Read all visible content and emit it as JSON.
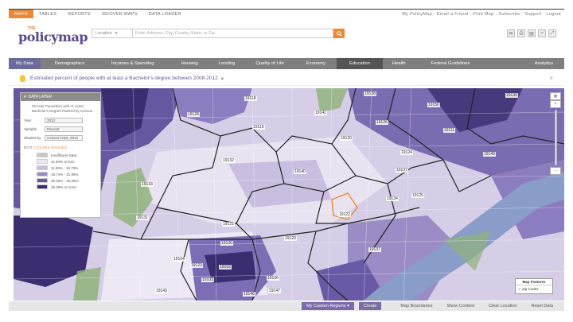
{
  "topnav": {
    "items": [
      "MAPS",
      "TABLES",
      "REPORTS",
      "3D/OVER MAPS",
      "DATA LOADER"
    ],
    "links": "My PolicyMap · Email a Friend · Print Map · Subscribe · Support · Logout"
  },
  "logo": {
    "the": "THE",
    "word": "policymap"
  },
  "search": {
    "location": "Location",
    "placeholder": "Enter Address, City, County, State, or Zip"
  },
  "menubar": {
    "items": [
      "My Data",
      "Demographics",
      "Incomes & Spending",
      "Housing",
      "Lending",
      "Quality of Life",
      "Economy",
      "Education",
      "Health",
      "Federal Guidelines",
      "Analytics"
    ],
    "active": "Education"
  },
  "title": "Estimated percent of people with at least a Bachelor's degree between 2008-2012",
  "panel": {
    "header": "DATA LAYER",
    "description": "Percent Population with At Least Bachelor's Degree Ranked by Census",
    "year_label": "Year",
    "year_value": "2012",
    "variable_label": "Variable",
    "variable_value": "Percent",
    "shaded_label": "Shaded by",
    "shaded_value": "Census Tract, 2012",
    "edit_label": "EDIT",
    "edit_colors": "COLORS",
    "edit_ranges": "RANGES",
    "legend": [
      {
        "label": "Insufficient Data",
        "color": "#c8c8c8"
      },
      {
        "label": "11.83% or less",
        "color": "#ede8f4"
      },
      {
        "label": "11.83% - 19.73%",
        "color": "#c9bedf"
      },
      {
        "label": "19.74% - 31.99%",
        "color": "#9b8cc6"
      },
      {
        "label": "32.00% - 45.28%",
        "color": "#6a5aa6"
      },
      {
        "label": "45.29% or more",
        "color": "#3b2d6f"
      }
    ]
  },
  "map": {
    "labels": [
      "19128",
      "19138",
      "19141",
      "19150",
      "19118",
      "19119",
      "19126",
      "19124",
      "19120",
      "19136",
      "19111",
      "19149",
      "19140",
      "19134",
      "19137",
      "19132",
      "19122",
      "19121",
      "19131",
      "19130",
      "19123",
      "19133",
      "19104",
      "19123",
      "19102",
      "19103",
      "19106",
      "19146",
      "19143",
      "19147",
      "19137",
      "19125"
    ],
    "legend_box_title": "Map Features",
    "legend_box_item": "Zip Codes"
  },
  "footer": {
    "regions": "My Custom Regions",
    "create": "Create",
    "map_boundaries": "Map Boundaries",
    "show_content": "Show Content",
    "clear_location": "Clear Location",
    "reset_data": "Reset Data"
  },
  "colors": {
    "accent": "#e8893b",
    "purple": "#6b5aa6",
    "menubar": "#7f7f7f"
  }
}
